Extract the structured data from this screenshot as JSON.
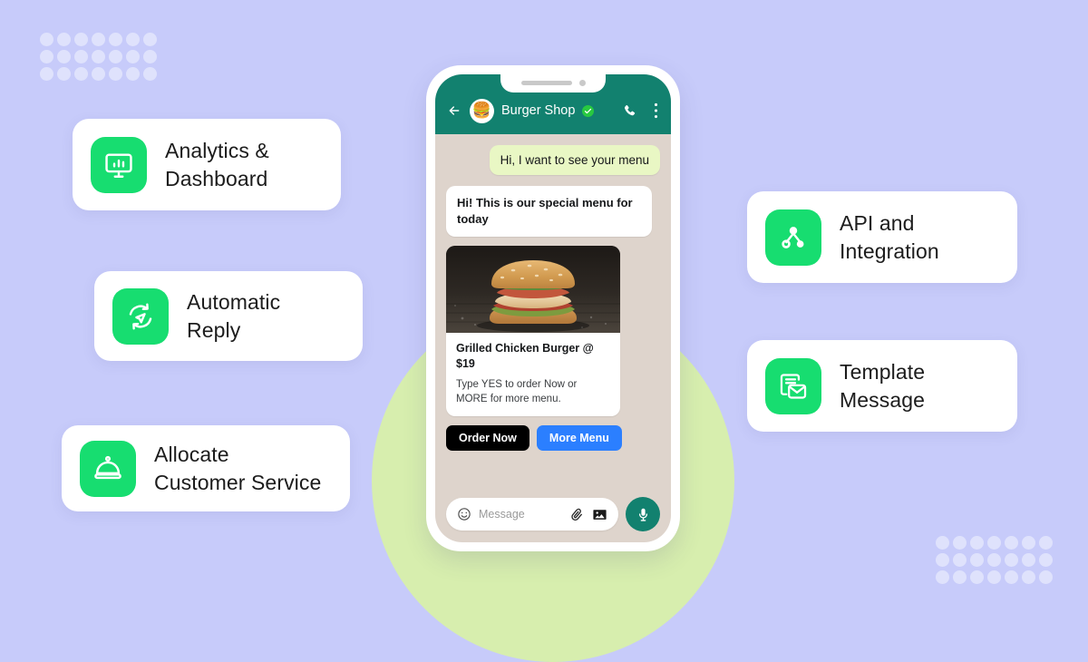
{
  "theme": {
    "background": "#c7cbfa",
    "dot_color": "#dfe2fc",
    "circle_backdrop": "#d7eeae",
    "accent_green": "#17dd70",
    "header_teal": "#12816f",
    "bubble_out": "#e9f7c4",
    "cta_dark": "#000000",
    "cta_blue": "#2b7fff"
  },
  "decoration": {
    "dot_grid_columns": 7,
    "dot_grid_rows": 3
  },
  "features_left": [
    {
      "id": "analytics-dashboard",
      "label": "Analytics &\nDashboard",
      "icon": "monitor-chart-icon"
    },
    {
      "id": "automatic-reply",
      "label": "Automatic\nReply",
      "icon": "auto-reply-refresh-icon"
    },
    {
      "id": "allocate-customer-service",
      "label": "Allocate\nCustomer Service",
      "icon": "service-dome-icon"
    }
  ],
  "features_right": [
    {
      "id": "api-integration",
      "label": "API and\nIntegration",
      "icon": "network-nodes-icon"
    },
    {
      "id": "template-message",
      "label": "Template\nMessage",
      "icon": "document-envelope-icon"
    }
  ],
  "phone": {
    "header": {
      "back_icon": "back-arrow-icon",
      "avatar_emoji": "🍔",
      "contact_name": "Burger Shop",
      "verified_badge": "verified-check-icon",
      "call_icon": "phone-call-icon",
      "menu_icon": "more-vertical-icon"
    },
    "messages": [
      {
        "id": "msg-customer-1",
        "direction": "outgoing",
        "text": "Hi, I want to see your menu"
      },
      {
        "id": "msg-shop-1",
        "direction": "incoming",
        "text": "Hi! This is our special menu for today"
      }
    ],
    "product_card": {
      "image_alt": "grilled-chicken-burger-photo",
      "title": "Grilled Chicken Burger @ $19",
      "description": "Type YES to order Now or MORE for more menu."
    },
    "cta_buttons": [
      {
        "id": "order-now",
        "label": "Order Now",
        "style": "dark"
      },
      {
        "id": "more-menu",
        "label": "More Menu",
        "style": "blue"
      }
    ],
    "input_bar": {
      "emoji_icon": "emoji-smiley-icon",
      "placeholder": "Message",
      "value": "",
      "attach_icon": "paperclip-icon",
      "gallery_icon": "image-icon",
      "mic_icon": "microphone-icon"
    }
  }
}
